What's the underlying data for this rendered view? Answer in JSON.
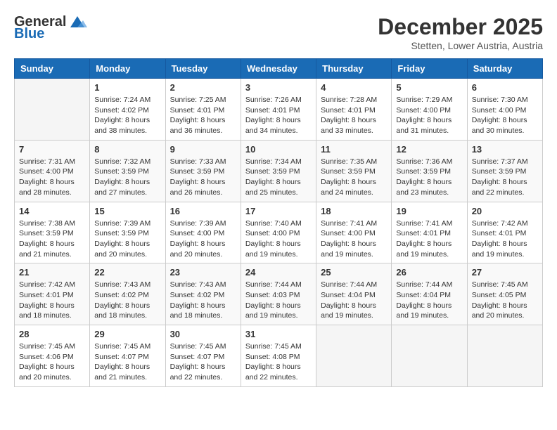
{
  "logo": {
    "general": "General",
    "blue": "Blue"
  },
  "title": "December 2025",
  "location": "Stetten, Lower Austria, Austria",
  "days_of_week": [
    "Sunday",
    "Monday",
    "Tuesday",
    "Wednesday",
    "Thursday",
    "Friday",
    "Saturday"
  ],
  "weeks": [
    [
      {
        "day": "",
        "info": ""
      },
      {
        "day": "1",
        "info": "Sunrise: 7:24 AM\nSunset: 4:02 PM\nDaylight: 8 hours\nand 38 minutes."
      },
      {
        "day": "2",
        "info": "Sunrise: 7:25 AM\nSunset: 4:01 PM\nDaylight: 8 hours\nand 36 minutes."
      },
      {
        "day": "3",
        "info": "Sunrise: 7:26 AM\nSunset: 4:01 PM\nDaylight: 8 hours\nand 34 minutes."
      },
      {
        "day": "4",
        "info": "Sunrise: 7:28 AM\nSunset: 4:01 PM\nDaylight: 8 hours\nand 33 minutes."
      },
      {
        "day": "5",
        "info": "Sunrise: 7:29 AM\nSunset: 4:00 PM\nDaylight: 8 hours\nand 31 minutes."
      },
      {
        "day": "6",
        "info": "Sunrise: 7:30 AM\nSunset: 4:00 PM\nDaylight: 8 hours\nand 30 minutes."
      }
    ],
    [
      {
        "day": "7",
        "info": "Sunrise: 7:31 AM\nSunset: 4:00 PM\nDaylight: 8 hours\nand 28 minutes."
      },
      {
        "day": "8",
        "info": "Sunrise: 7:32 AM\nSunset: 3:59 PM\nDaylight: 8 hours\nand 27 minutes."
      },
      {
        "day": "9",
        "info": "Sunrise: 7:33 AM\nSunset: 3:59 PM\nDaylight: 8 hours\nand 26 minutes."
      },
      {
        "day": "10",
        "info": "Sunrise: 7:34 AM\nSunset: 3:59 PM\nDaylight: 8 hours\nand 25 minutes."
      },
      {
        "day": "11",
        "info": "Sunrise: 7:35 AM\nSunset: 3:59 PM\nDaylight: 8 hours\nand 24 minutes."
      },
      {
        "day": "12",
        "info": "Sunrise: 7:36 AM\nSunset: 3:59 PM\nDaylight: 8 hours\nand 23 minutes."
      },
      {
        "day": "13",
        "info": "Sunrise: 7:37 AM\nSunset: 3:59 PM\nDaylight: 8 hours\nand 22 minutes."
      }
    ],
    [
      {
        "day": "14",
        "info": "Sunrise: 7:38 AM\nSunset: 3:59 PM\nDaylight: 8 hours\nand 21 minutes."
      },
      {
        "day": "15",
        "info": "Sunrise: 7:39 AM\nSunset: 3:59 PM\nDaylight: 8 hours\nand 20 minutes."
      },
      {
        "day": "16",
        "info": "Sunrise: 7:39 AM\nSunset: 4:00 PM\nDaylight: 8 hours\nand 20 minutes."
      },
      {
        "day": "17",
        "info": "Sunrise: 7:40 AM\nSunset: 4:00 PM\nDaylight: 8 hours\nand 19 minutes."
      },
      {
        "day": "18",
        "info": "Sunrise: 7:41 AM\nSunset: 4:00 PM\nDaylight: 8 hours\nand 19 minutes."
      },
      {
        "day": "19",
        "info": "Sunrise: 7:41 AM\nSunset: 4:01 PM\nDaylight: 8 hours\nand 19 minutes."
      },
      {
        "day": "20",
        "info": "Sunrise: 7:42 AM\nSunset: 4:01 PM\nDaylight: 8 hours\nand 19 minutes."
      }
    ],
    [
      {
        "day": "21",
        "info": "Sunrise: 7:42 AM\nSunset: 4:01 PM\nDaylight: 8 hours\nand 18 minutes."
      },
      {
        "day": "22",
        "info": "Sunrise: 7:43 AM\nSunset: 4:02 PM\nDaylight: 8 hours\nand 18 minutes."
      },
      {
        "day": "23",
        "info": "Sunrise: 7:43 AM\nSunset: 4:02 PM\nDaylight: 8 hours\nand 18 minutes."
      },
      {
        "day": "24",
        "info": "Sunrise: 7:44 AM\nSunset: 4:03 PM\nDaylight: 8 hours\nand 19 minutes."
      },
      {
        "day": "25",
        "info": "Sunrise: 7:44 AM\nSunset: 4:04 PM\nDaylight: 8 hours\nand 19 minutes."
      },
      {
        "day": "26",
        "info": "Sunrise: 7:44 AM\nSunset: 4:04 PM\nDaylight: 8 hours\nand 19 minutes."
      },
      {
        "day": "27",
        "info": "Sunrise: 7:45 AM\nSunset: 4:05 PM\nDaylight: 8 hours\nand 20 minutes."
      }
    ],
    [
      {
        "day": "28",
        "info": "Sunrise: 7:45 AM\nSunset: 4:06 PM\nDaylight: 8 hours\nand 20 minutes."
      },
      {
        "day": "29",
        "info": "Sunrise: 7:45 AM\nSunset: 4:07 PM\nDaylight: 8 hours\nand 21 minutes."
      },
      {
        "day": "30",
        "info": "Sunrise: 7:45 AM\nSunset: 4:07 PM\nDaylight: 8 hours\nand 22 minutes."
      },
      {
        "day": "31",
        "info": "Sunrise: 7:45 AM\nSunset: 4:08 PM\nDaylight: 8 hours\nand 22 minutes."
      },
      {
        "day": "",
        "info": ""
      },
      {
        "day": "",
        "info": ""
      },
      {
        "day": "",
        "info": ""
      }
    ]
  ]
}
